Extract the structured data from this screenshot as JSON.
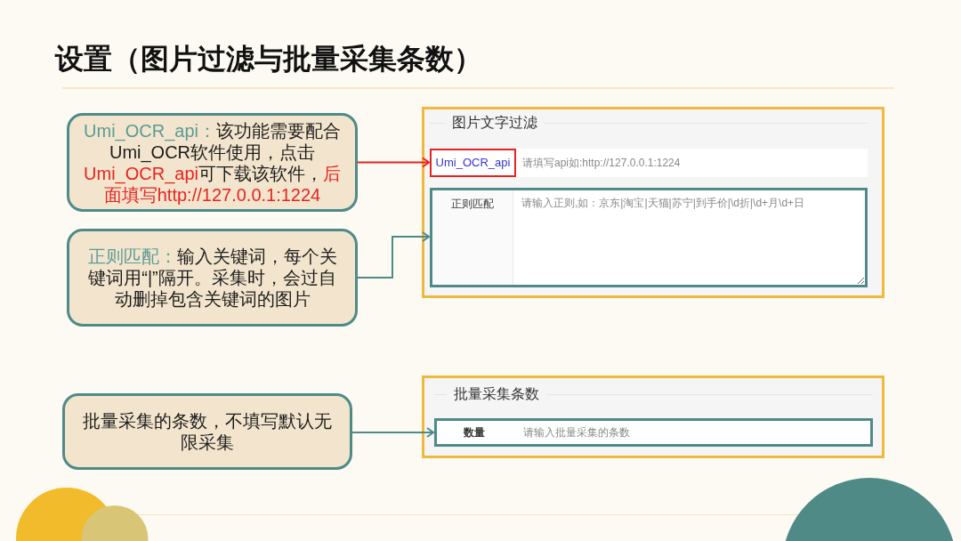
{
  "title": "设置（图片过滤与批量采集条数）",
  "sections": [
    {
      "callouts": [
        {
          "color": "#e8231f",
          "segments": [
            {
              "kind": "key",
              "text": "Umi_OCR_api："
            },
            {
              "kind": "plain",
              "text": "该功能需要配合Umi_OCR软件使用，点击"
            },
            {
              "kind": "alert",
              "text": "Umi_OCR_api"
            },
            {
              "kind": "plain",
              "text": "可下载该软件，"
            },
            {
              "kind": "alert",
              "text": "后面填写http://127.0.0.1:1224"
            }
          ]
        },
        {
          "color": "#4e8b88",
          "segments": [
            {
              "kind": "key",
              "text": "正则匹配："
            },
            {
              "kind": "plain",
              "text": "输入关键词，每个关键词用“|”隔开。采集时，会过自动删掉包含关键词的图片"
            }
          ]
        }
      ],
      "panel": {
        "legend": "图片文字过滤",
        "fields": [
          {
            "kind": "input",
            "label": {
              "kind": "link",
              "text": "Umi_OCR_api"
            },
            "placeholder": "请填写api如:http://127.0.0.1:1224",
            "highlight": {
              "kind": "label",
              "color": "#e8231f"
            }
          },
          {
            "kind": "textarea",
            "label": {
              "kind": "plain",
              "text": "正则匹配"
            },
            "placeholder": "请输入正则,如：京东|淘宝|天猫|苏宁|到手价|\\d折|\\d+月\\d+日",
            "highlight": {
              "kind": "row",
              "color": "#4e8b88"
            }
          }
        ]
      }
    },
    {
      "callouts": [
        {
          "color": "#4e8b88",
          "segments": [
            {
              "kind": "plain",
              "text": "批量采集的条数，不填写默认无限采集"
            }
          ]
        }
      ],
      "panel": {
        "legend": "批量采集条数",
        "fields": [
          {
            "kind": "input",
            "label": {
              "kind": "bold",
              "text": "数量"
            },
            "placeholder": "请输入批量采集的条数",
            "highlight": {
              "kind": "row",
              "color": "#4e8b88"
            }
          }
        ]
      }
    }
  ]
}
